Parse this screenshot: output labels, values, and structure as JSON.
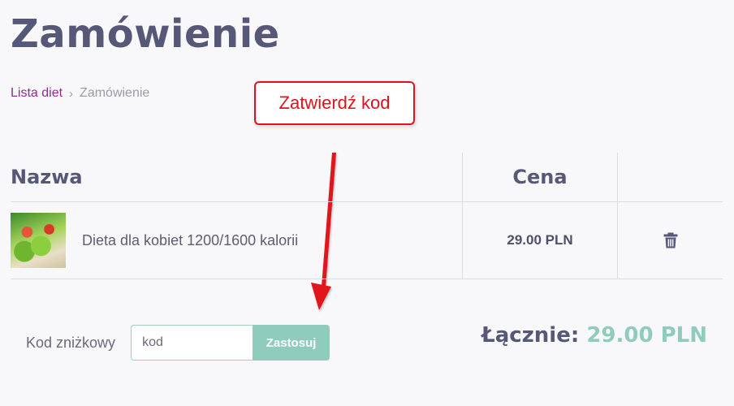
{
  "page": {
    "title": "Zamówienie"
  },
  "breadcrumb": {
    "items": [
      "Lista diet",
      "Zamówienie"
    ]
  },
  "annotation": {
    "callout_text": "Zatwierdź kod",
    "color": "#e0121b"
  },
  "table": {
    "headers": {
      "name": "Nazwa",
      "price": "Cena"
    },
    "rows": [
      {
        "name": "Dieta dla kobiet 1200/1600 kalorii",
        "price": "29.00 PLN",
        "action_icon": "trash-icon"
      }
    ]
  },
  "discount": {
    "label": "Kod zniżkowy",
    "value": "kod",
    "button_label": "Zastosuj"
  },
  "total": {
    "label": "Łącznie:",
    "value": "29.00 PLN"
  },
  "colors": {
    "accent": "#8fccbc",
    "title": "#575778",
    "link": "#8e2c8e"
  }
}
